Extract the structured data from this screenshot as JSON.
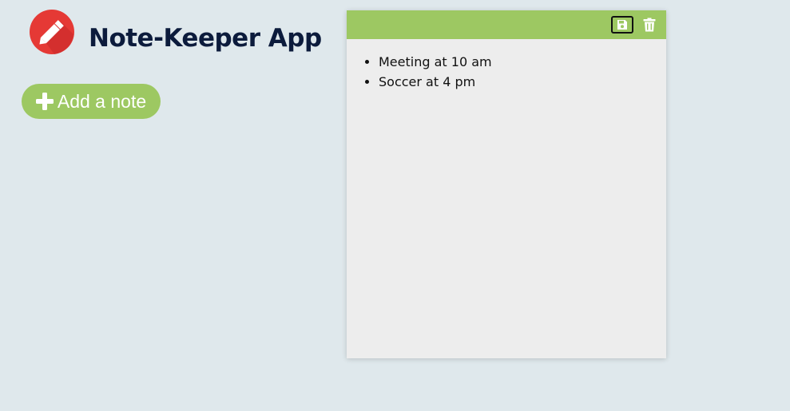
{
  "app": {
    "title": "Note-Keeper App",
    "logo_icon": "pencil-icon"
  },
  "actions": {
    "add_note_label": "Add a note",
    "add_icon": "plus-icon"
  },
  "note": {
    "toolbar": {
      "save_icon": "save-icon",
      "delete_icon": "trash-icon"
    },
    "items": [
      "Meeting at 10 am",
      "Soccer at 4 pm"
    ]
  },
  "colors": {
    "background": "#dfe8ec",
    "accent_green": "#9dc862",
    "title": "#0c1b3c",
    "note_background": "#ededed",
    "logo_red": "#e53935"
  }
}
